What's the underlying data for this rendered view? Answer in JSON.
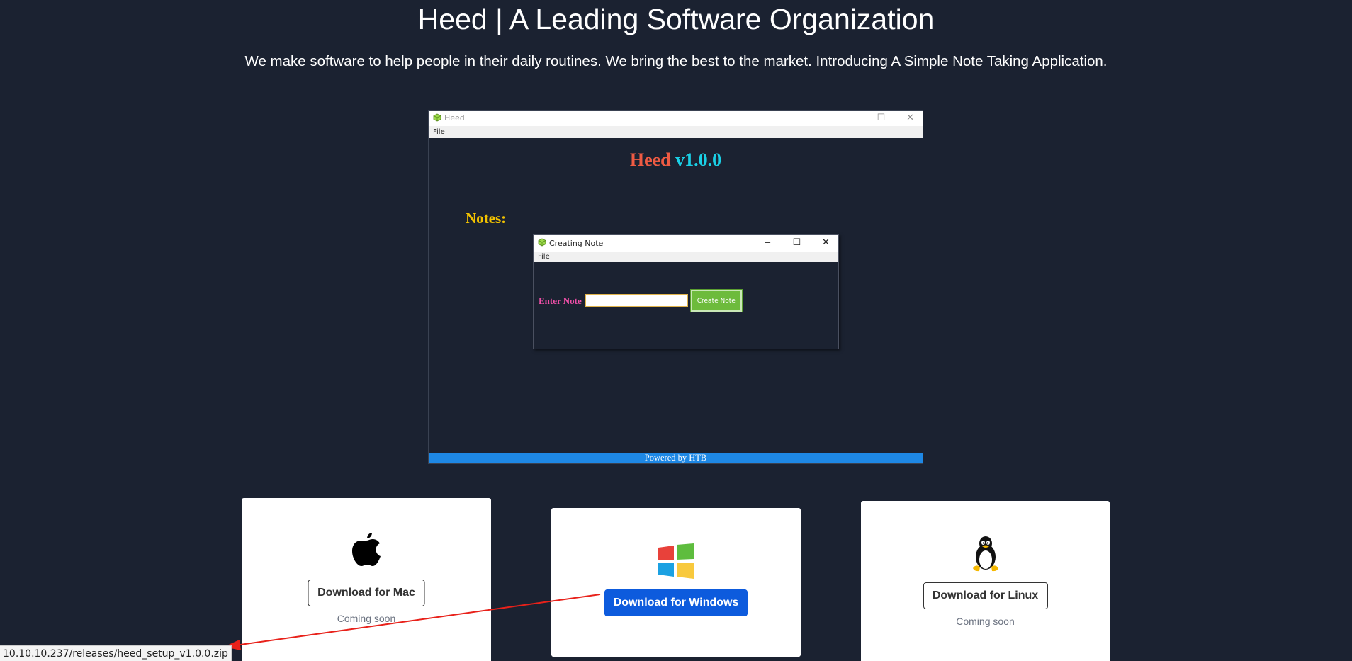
{
  "hero": {
    "title": "Heed | A Leading Software Organization",
    "subtitle": "We make software to help people in their daily routines. We bring the best to the market. Introducing A Simple Note Taking Application."
  },
  "app_preview": {
    "window_title": "Heed",
    "menu_file": "File",
    "heading_name": "Heed",
    "heading_version": "v1.0.0",
    "notes_label": "Notes:",
    "footer": "Powered by HTB",
    "dialog": {
      "title": "Creating Note",
      "menu_file": "File",
      "enter_label": "Enter Note",
      "input_value": "",
      "button_label": "Create Note"
    }
  },
  "downloads": {
    "mac": {
      "icon": "apple-icon",
      "label": "Download for Mac",
      "status": "Coming soon"
    },
    "windows": {
      "icon": "windows-icon",
      "label": "Download for Windows"
    },
    "linux": {
      "icon": "linux-tux-icon",
      "label": "Download for Linux",
      "status": "Coming soon"
    }
  },
  "status_bar": {
    "url": "10.10.10.237/releases/heed_setup_v1.0.0.zip"
  },
  "colors": {
    "background": "#1b2231",
    "heed_red": "#ef5b43",
    "version_cyan": "#1ad0e6",
    "notes_yellow": "#f2c200",
    "enter_pink": "#ef4fa8",
    "create_green": "#6dbb3c",
    "footer_blue": "#1e88e5",
    "windows_btn_blue": "#0d5bdd",
    "annotation_red": "#e8211a"
  }
}
